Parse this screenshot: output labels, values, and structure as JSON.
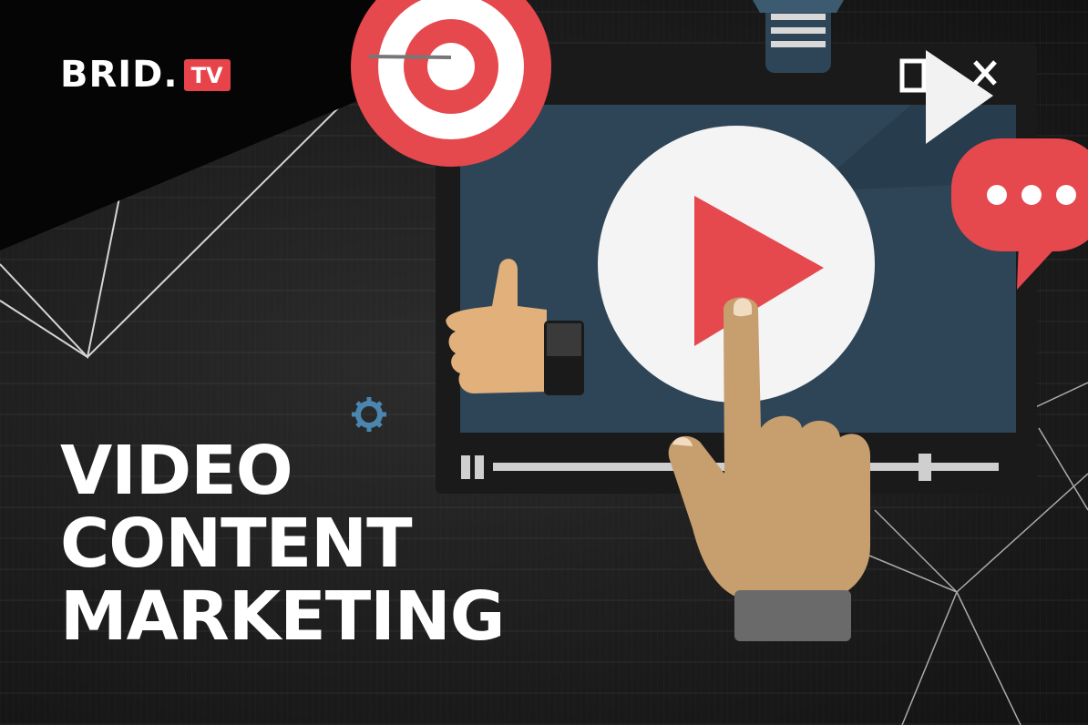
{
  "logo": {
    "brand": "BRID.",
    "suffix": "TV"
  },
  "headline": {
    "line1": "VIDEO",
    "line2": "CONTENT",
    "line3": "MARKETING"
  },
  "colors": {
    "accent": "#e7434b",
    "screen": "#2e4558",
    "skin": "#c9a070"
  },
  "icons": [
    "target-icon",
    "lightbulb-icon",
    "play-button-icon",
    "thumbs-up-icon",
    "speech-bubble-icon",
    "gear-icon",
    "pointing-hand-icon",
    "mute-icon"
  ]
}
